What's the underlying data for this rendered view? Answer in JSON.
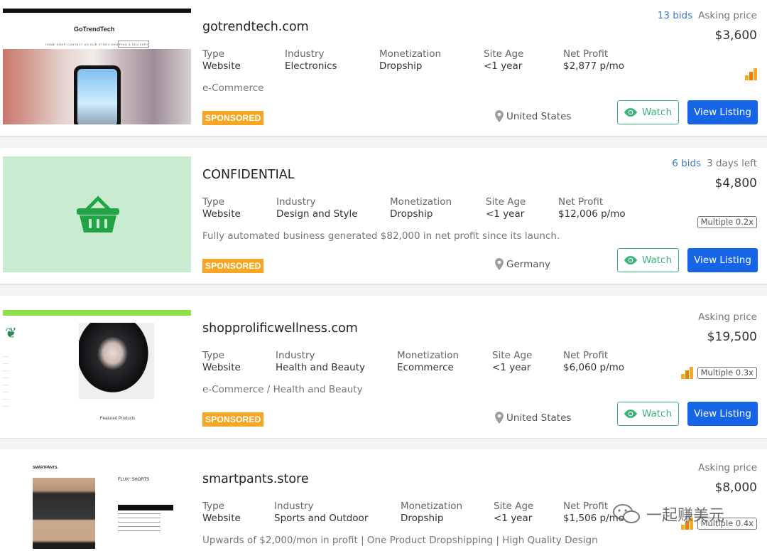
{
  "listings": [
    {
      "title": "gotrendtech.com",
      "type_label": "Type",
      "type": "Website",
      "industry_label": "Industry",
      "industry": "Electronics",
      "monetization_label": "Monetization",
      "monetization": "Dropship",
      "site_age_label": "Site Age",
      "site_age": "<1 year",
      "net_profit_label": "Net Profit",
      "net_profit": "$2,877 p/mo",
      "description": "e-Commerce",
      "badge": "SPONSORED",
      "location": "United States",
      "bids": "13 bids",
      "status": "Asking price",
      "price": "$3,600",
      "multiple": "",
      "watch_label": "Watch",
      "view_label": "View Listing",
      "thumb": {
        "logo": "GoTrendTech",
        "nav": "HOME  SHOP  CONTACT US  OUR STORY  SHIPPING & DELIVERY"
      }
    },
    {
      "title": "CONFIDENTIAL",
      "type_label": "Type",
      "type": "Website",
      "industry_label": "Industry",
      "industry": "Design and Style",
      "monetization_label": "Monetization",
      "monetization": "Dropship",
      "site_age_label": "Site Age",
      "site_age": "<1 year",
      "net_profit_label": "Net Profit",
      "net_profit": "$12,006 p/mo",
      "description": "Fully automated business generated $82,000 in net profit since its launch.",
      "badge": "SPONSORED",
      "location": "Germany",
      "bids": "6 bids",
      "status": "3 days left",
      "price": "$4,800",
      "multiple": "Multiple 0.2x",
      "watch_label": "Watch",
      "view_label": "View Listing"
    },
    {
      "title": "shopprolificwellness.com",
      "type_label": "Type",
      "type": "Website",
      "industry_label": "Industry",
      "industry": "Health and Beauty",
      "monetization_label": "Monetization",
      "monetization": "Ecommerce",
      "site_age_label": "Site Age",
      "site_age": "<1 year",
      "net_profit_label": "Net Profit",
      "net_profit": "$6,060 p/mo",
      "description": "e-Commerce / Health and Beauty",
      "badge": "SPONSORED",
      "location": "United States",
      "bids": "",
      "status": "Asking price",
      "price": "$19,500",
      "multiple": "Multiple 0.3x",
      "watch_label": "Watch",
      "view_label": "View Listing",
      "thumb": {
        "caption": "Featured Products"
      }
    },
    {
      "title": "smartpants.store",
      "type_label": "Type",
      "type": "Website",
      "industry_label": "Industry",
      "industry": "Sports and Outdoor",
      "monetization_label": "Monetization",
      "monetization": "Dropship",
      "site_age_label": "Site Age",
      "site_age": "<1 year",
      "net_profit_label": "Net Profit",
      "net_profit": "$1,506 p/mo",
      "description": "Upwards of $2,000/mon in profit | One Product Dropshipping | High Quality Design",
      "bids": "",
      "status": "Asking price",
      "price": "$8,000",
      "multiple": "Multiple 0.4x",
      "thumb": {
        "logo": "SMARTPANTS.",
        "product": "FLUX° SHORTS"
      }
    }
  ],
  "watermark": "一起赚美元",
  "colors": {
    "accent_blue": "#1565e6",
    "watch_green": "#3bb37b",
    "sponsored_orange": "#f6a623",
    "bids_link": "#3b78c6"
  }
}
